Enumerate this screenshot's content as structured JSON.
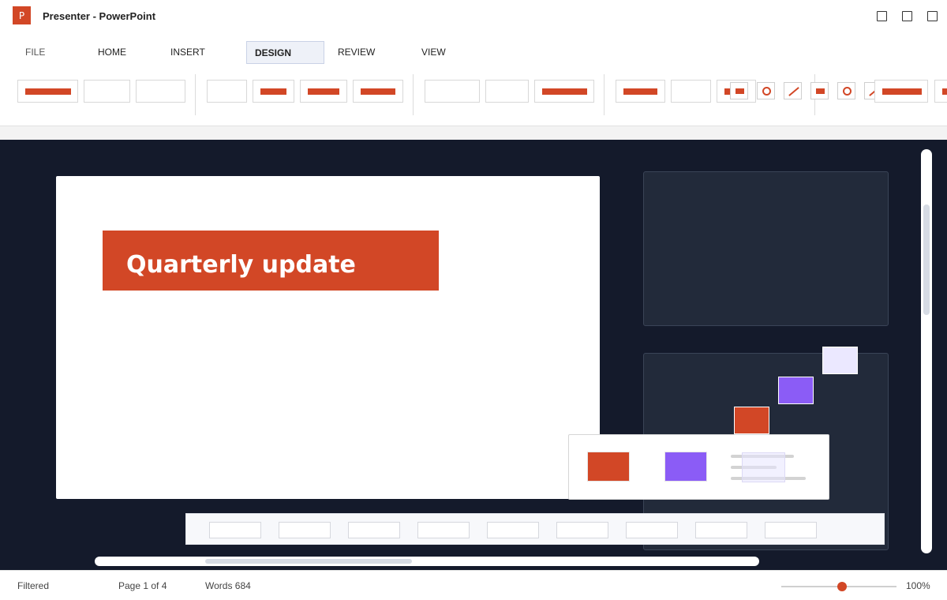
{
  "window": {
    "app_icon_letter": "P",
    "title": "Presenter - PowerPoint"
  },
  "tabs": [
    {
      "label": "FILE",
      "active": false
    },
    {
      "label": "HOME",
      "active": false
    },
    {
      "label": "INSERT",
      "active": false
    },
    {
      "label": "DESIGN",
      "active": true
    },
    {
      "label": "REVIEW",
      "active": false
    },
    {
      "label": "VIEW",
      "active": false
    }
  ],
  "slide": {
    "title": "Quarterly update"
  },
  "colors": {
    "accent": "#d24726",
    "purple": "#8b5cf6",
    "lavender": "#ebe8ff",
    "canvas": "#141a2b",
    "panel": "#222a3a"
  },
  "statusbar": {
    "filter": "Filtered",
    "page": "Page 1 of 4",
    "words": "Words 684",
    "zoom": "100%",
    "zoom_slider_fraction": 0.52
  }
}
